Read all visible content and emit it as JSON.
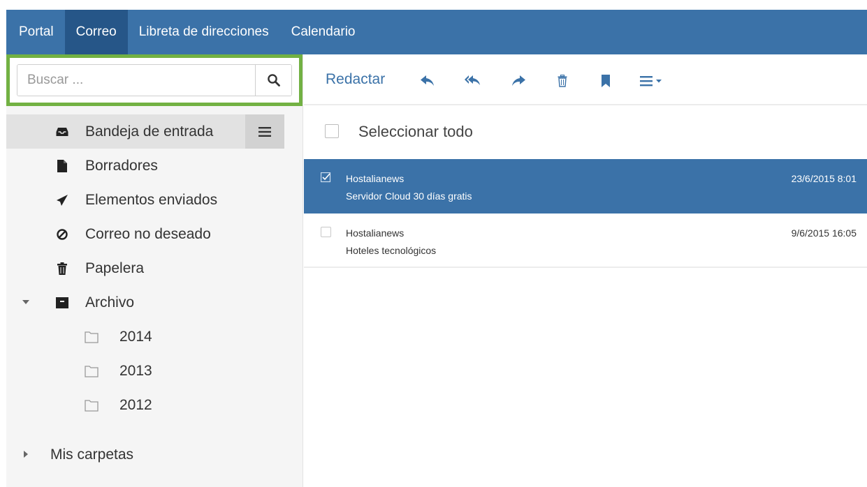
{
  "nav": {
    "items": [
      {
        "label": "Portal"
      },
      {
        "label": "Correo"
      },
      {
        "label": "Libreta de direcciones"
      },
      {
        "label": "Calendario"
      }
    ],
    "active_index": 1
  },
  "search": {
    "placeholder": "Buscar ...",
    "value": "",
    "icon": "search-icon"
  },
  "folders": [
    {
      "label": "Bandeja de entrada",
      "icon": "inbox-icon",
      "active": true
    },
    {
      "label": "Borradores",
      "icon": "draft-file-icon"
    },
    {
      "label": "Elementos enviados",
      "icon": "paper-plane-icon"
    },
    {
      "label": "Correo no deseado",
      "icon": "ban-icon"
    },
    {
      "label": "Papelera",
      "icon": "trash-icon"
    },
    {
      "label": "Archivo",
      "icon": "archive-icon",
      "expanded": true
    }
  ],
  "archive_subfolders": [
    {
      "label": "2014",
      "icon": "folder-outline-icon"
    },
    {
      "label": "2013",
      "icon": "folder-outline-icon"
    },
    {
      "label": "2012",
      "icon": "folder-outline-icon"
    }
  ],
  "my_folders": {
    "label": "Mis carpetas",
    "expanded": false
  },
  "toolbar": {
    "compose_label": "Redactar",
    "buttons": [
      "reply-icon",
      "reply-all-icon",
      "forward-icon",
      "delete-icon",
      "bookmark-icon",
      "more-menu-icon"
    ]
  },
  "select_all": {
    "label": "Seleccionar todo",
    "checked": false
  },
  "messages": [
    {
      "sender": "Hostalianews",
      "subject": "Servidor Cloud 30 días gratis",
      "date": "23/6/2015 8:01",
      "selected": true
    },
    {
      "sender": "Hostalianews",
      "subject": "Hoteles tecnológicos",
      "date": "9/6/2015 16:05",
      "selected": false
    }
  ],
  "colors": {
    "nav_bg": "#3b72a8",
    "nav_active": "#265688",
    "accent": "#3b72a8",
    "search_highlight": "#72b143",
    "selected_row": "#3b72a8"
  }
}
